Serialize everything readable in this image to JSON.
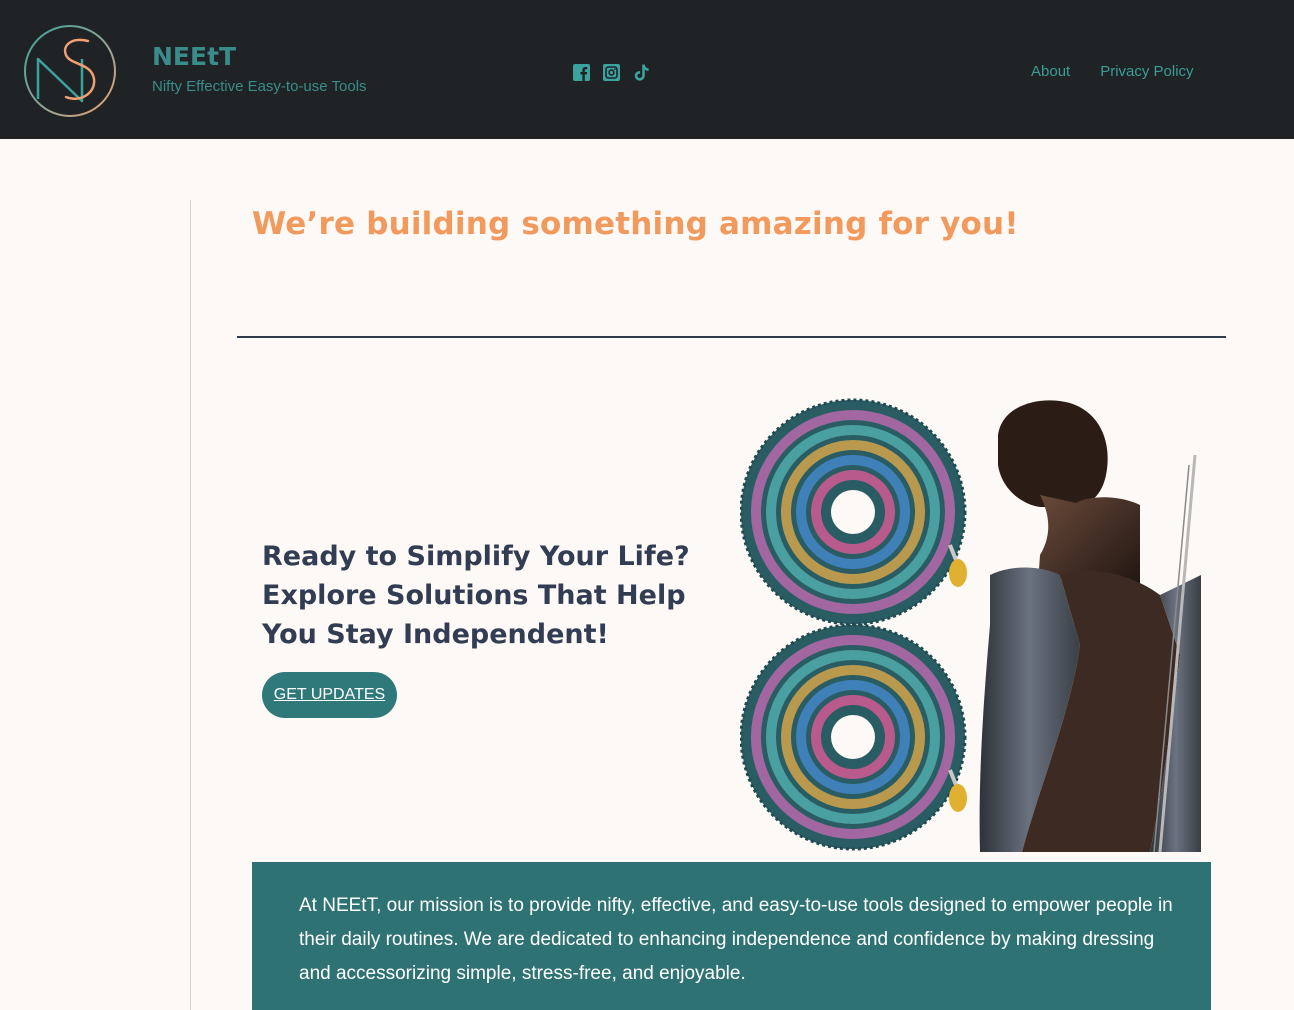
{
  "header": {
    "brand_title": "NEEtT",
    "brand_tagline": "Nifty Effective Easy-to-use Tools",
    "logo_monogram": "SN",
    "social": [
      {
        "icon": "facebook-icon"
      },
      {
        "icon": "instagram-icon"
      },
      {
        "icon": "tiktok-icon"
      }
    ],
    "nav": [
      {
        "label": "About"
      },
      {
        "label": "Privacy Policy"
      }
    ]
  },
  "hero": {
    "title": "We’re building something amazing for you!"
  },
  "cta": {
    "heading": "Ready to Simplify Your Life? Explore Solutions That Help You Stay Independent!",
    "button_label": "GET UPDATES"
  },
  "mission": {
    "text": "At NEEtT, our mission is to provide nifty, effective, and easy-to-use tools designed to empower people in their daily routines. We are dedicated to enhancing independence and confidence by making dressing and accessorizing simple, stress-free, and enjoyable."
  },
  "colors": {
    "header_bg": "#1f2326",
    "brand_teal": "#3a8c8a",
    "accent_orange": "#f29a5e",
    "heading_navy": "#323c53",
    "button_teal": "#30797a",
    "mission_bg": "#2f7273",
    "page_bg": "#fdf9f6"
  }
}
